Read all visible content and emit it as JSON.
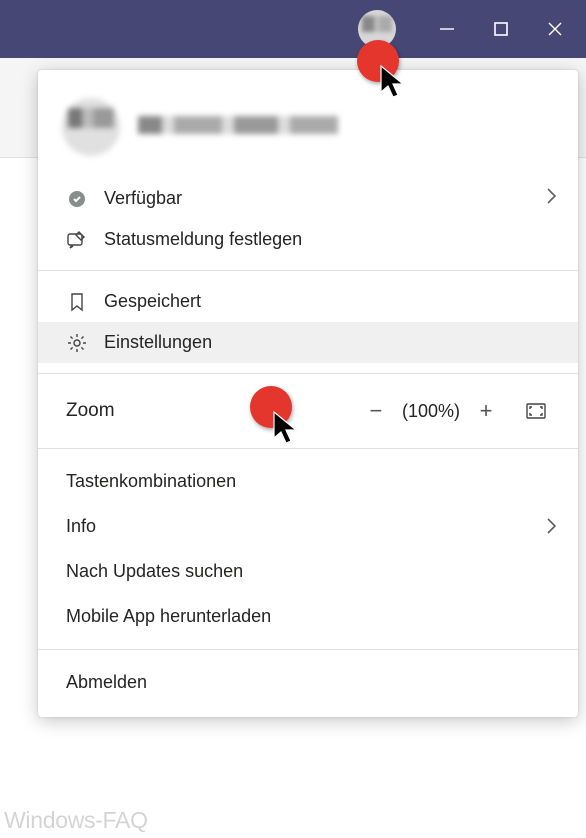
{
  "titlebar": {
    "minimize_title": "Minimieren",
    "maximize_title": "Maximieren",
    "close_title": "Schließen"
  },
  "menu": {
    "status_label": "Verfügbar",
    "set_status_label": "Statusmeldung festlegen",
    "saved_label": "Gespeichert",
    "settings_label": "Einstellungen",
    "zoom": {
      "label": "Zoom",
      "value": "(100%)",
      "minus": "−",
      "plus": "+"
    },
    "shortcuts_label": "Tastenkombinationen",
    "about_label": "Info",
    "updates_label": "Nach Updates suchen",
    "mobile_label": "Mobile App herunterladen",
    "signout_label": "Abmelden"
  },
  "watermark": "Windows-FAQ"
}
